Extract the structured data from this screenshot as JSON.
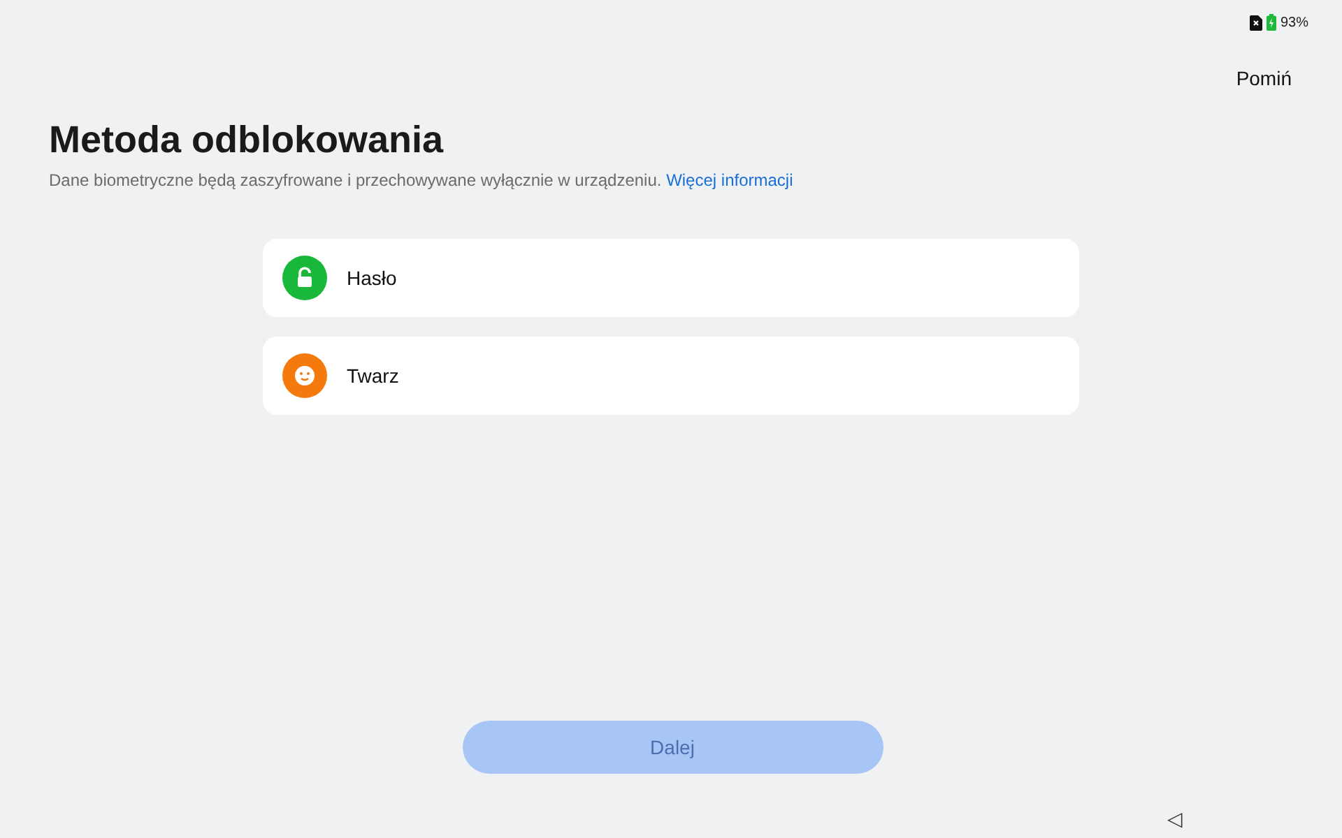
{
  "status_bar": {
    "battery": "93%"
  },
  "skip": "Pomiń",
  "title": "Metoda odblokowania",
  "subtitle": "Dane biometryczne będą zaszyfrowane i przechowywane wyłącznie w urządzeniu.",
  "more_link": "Więcej informacji",
  "options": [
    {
      "kind": "lock",
      "label": "Hasło",
      "color": "#1ab83a"
    },
    {
      "kind": "face",
      "label": "Twarz",
      "color": "#f57a0e"
    }
  ],
  "next_button": {
    "label": "Dalej",
    "disabled": true
  },
  "nav": {
    "back": "◁"
  }
}
